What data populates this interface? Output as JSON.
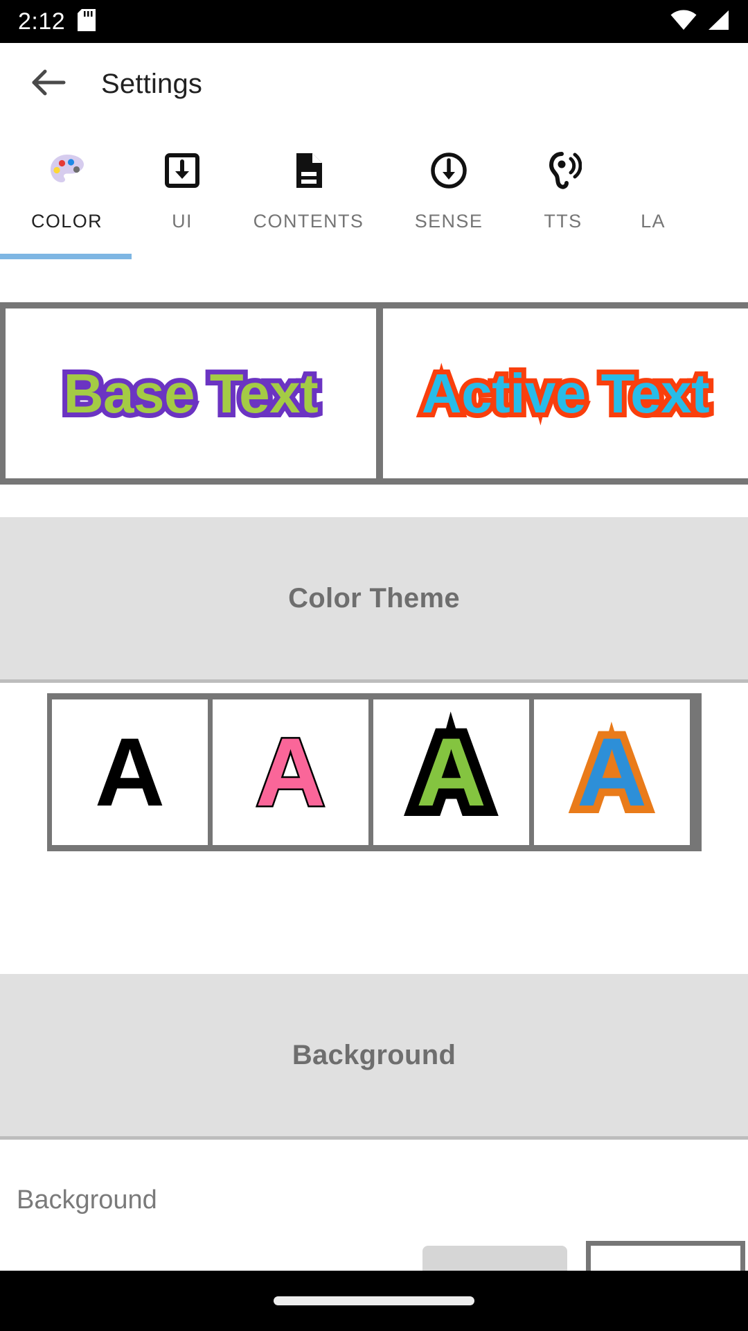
{
  "status_bar": {
    "time": "2:12",
    "icons": [
      {
        "name": "sd-card-icon"
      },
      {
        "name": "wifi-icon"
      },
      {
        "name": "cellular-signal-icon"
      }
    ]
  },
  "app_bar": {
    "back_icon": "arrow-back-icon",
    "title": "Settings"
  },
  "tabs": {
    "selected_index": 0,
    "items": [
      {
        "label": "COLOR",
        "icon": "palette-icon",
        "selected": true
      },
      {
        "label": "UI",
        "icon": "download-box-icon",
        "selected": false
      },
      {
        "label": "CONTENTS",
        "icon": "document-icon",
        "selected": false
      },
      {
        "label": "SENSE",
        "icon": "circle-arrow-down-icon",
        "selected": false
      },
      {
        "label": "TTS",
        "icon": "hearing-icon",
        "selected": false
      },
      {
        "label": "LA",
        "icon": "",
        "selected": false
      }
    ]
  },
  "preview": {
    "base": {
      "text": "Base Text",
      "fill_color": "#A4CB45",
      "outline_color": "#6B34C2"
    },
    "active": {
      "text": "Active Text",
      "fill_color": "#28BCE8",
      "outline_color": "#F93F0D"
    }
  },
  "color_theme": {
    "title": "Color Theme",
    "swatches": [
      {
        "letter": "A",
        "fill_color": "#000000",
        "outline_color": "#000000",
        "name": "theme-swatch-black"
      },
      {
        "letter": "A",
        "fill_color": "#FA6699",
        "outline_color": "#000000",
        "name": "theme-swatch-pink"
      },
      {
        "letter": "A",
        "fill_color": "#84C440",
        "outline_color": "#000000",
        "name": "theme-swatch-green"
      },
      {
        "letter": "A",
        "fill_color": "#2D8FD8",
        "outline_color": "#E97B1A",
        "name": "theme-swatch-blue"
      }
    ]
  },
  "background_section": {
    "title": "Background",
    "row_label": "Background"
  },
  "nav_bar": {
    "home_indicator": "home-indicator"
  },
  "colors": {
    "accent": "#7EB6E3",
    "swatch_border": "#767676",
    "band_bg": "#E0E0E0",
    "band_text": "#6E6E6E"
  }
}
